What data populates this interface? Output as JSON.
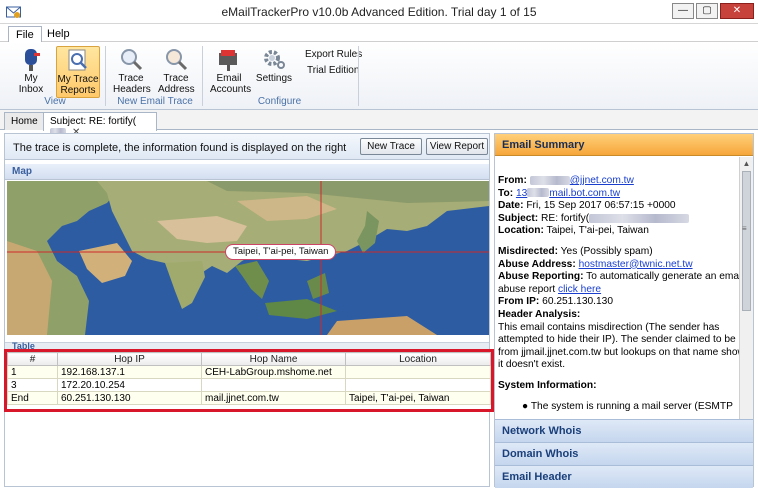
{
  "window": {
    "title": "eMailTrackerPro v10.0b Advanced Edition. Trial day 1 of 15",
    "minimize": "—",
    "maximize": "▢",
    "close": "✕"
  },
  "menu": {
    "file": "File",
    "help": "Help"
  },
  "ribbon": {
    "my_inbox": "My Inbox",
    "my_trace_reports": "My Trace Reports",
    "group_view": "View",
    "trace_headers": "Trace Headers",
    "trace_address": "Trace Address",
    "group_new_trace": "New Email Trace",
    "email_accounts": "Email Accounts",
    "settings": "Settings",
    "export_rules": "Export Rules",
    "trial_edition": "Trial Edition",
    "group_configure": "Configure"
  },
  "tabs": {
    "home": "Home",
    "subject": "Subject: RE: fortify(",
    "close": "✕"
  },
  "trace": {
    "status": "The trace is complete, the information found is displayed on the right",
    "new_trace": "New Trace",
    "view_report": "View Report",
    "map_label": "Map",
    "location_label": "Taipei, T'ai-pei, Taiwan",
    "table_label": "Table"
  },
  "hop_table": {
    "columns": [
      "#",
      "Hop IP",
      "Hop Name",
      "Location"
    ],
    "rows": [
      [
        "1",
        "192.168.137.1",
        "CEH-LabGroup.mshome.net",
        ""
      ],
      [
        "3",
        "172.20.10.254",
        "",
        ""
      ],
      [
        "End",
        "60.251.130.130",
        "mail.jjnet.com.tw",
        "Taipei, T'ai-pei, Taiwan"
      ]
    ]
  },
  "summary": {
    "header": "Email Summary",
    "from_label": "From:",
    "from_value": "@jjnet.com.tw",
    "to_label": "To:",
    "to_value": "13",
    "to_value2": "mail.bot.com.tw",
    "date_label": "Date:",
    "date_value": "Fri, 15 Sep 2017 06:57:15 +0000",
    "subject_label": "Subject:",
    "subject_value": "RE: fortify(",
    "location_label": "Location:",
    "location_value": "Taipei, T'ai-pei, Taiwan",
    "misdirected_label": "Misdirected:",
    "misdirected_value": "Yes (Possibly spam)",
    "abuse_address_label": "Abuse Address:",
    "abuse_address_value": "hostmaster@twnic.net.tw",
    "abuse_reporting_label": "Abuse Reporting:",
    "abuse_reporting_line1": "To automatically generate an email",
    "abuse_reporting_line2": "abuse report",
    "click_here": "click here",
    "from_ip_label": "From IP:",
    "from_ip_value": "60.251.130.130",
    "header_analysis_label": "Header Analysis:",
    "analysis_l1": "This email contains misdirection (The sender has",
    "analysis_l2": "attempted to hide their IP). The sender claimed to be",
    "analysis_l3": "from jjmail.jjnet.com.tw but lookups on that name shows",
    "analysis_l4": "it doesn't exist.",
    "system_info_label": "System Information:",
    "system_bullet": "The system is running a mail server (ESMTP",
    "network_whois": "Network Whois",
    "domain_whois": "Domain Whois",
    "email_header": "Email Header"
  }
}
